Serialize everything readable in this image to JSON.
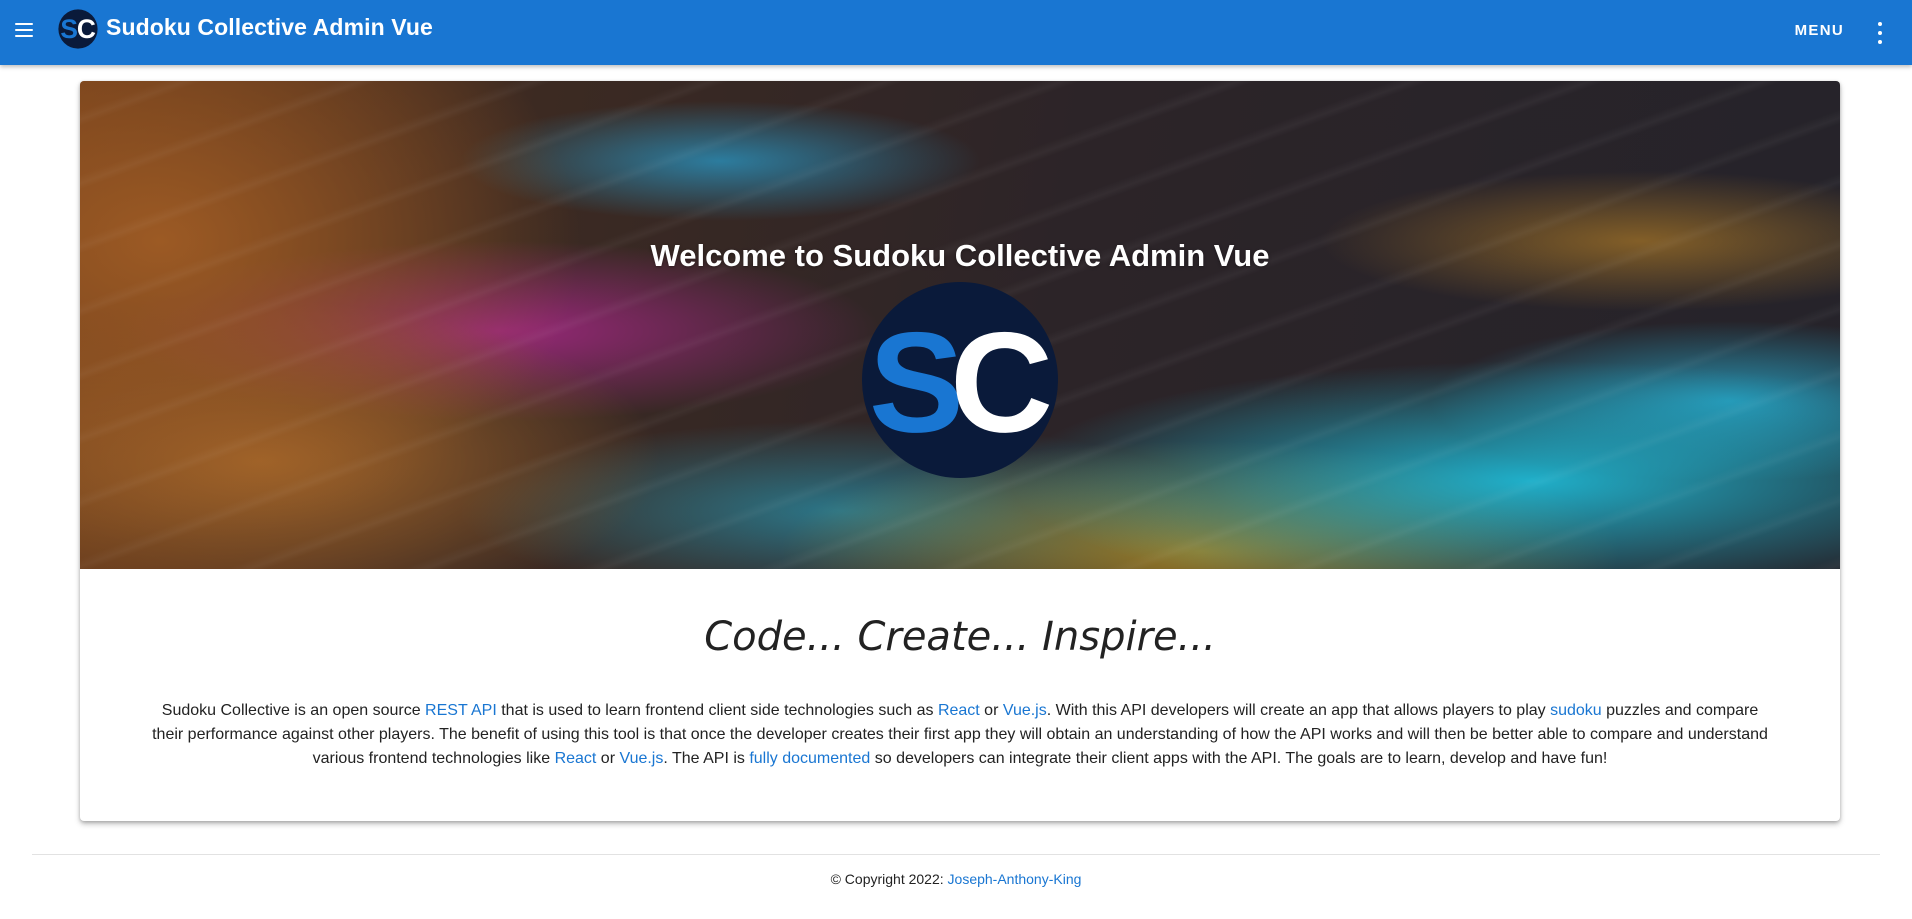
{
  "appbar": {
    "title": "Sudoku Collective Admin Vue",
    "logo_text": "SC",
    "menu_label": "MENU",
    "nav_icon": "hamburger-menu-icon",
    "overflow_icon": "more-vert-icon",
    "color": "#1976d2"
  },
  "hero": {
    "title": "Welcome to Sudoku Collective Admin Vue",
    "logo_text": "SC"
  },
  "tagline": "Code... Create... Inspire...",
  "description": {
    "seg1": "Sudoku Collective is an open source ",
    "link_rest_api": "REST API",
    "seg2": " that is used to learn frontend client side technologies such as ",
    "link_react_1": "React",
    "seg3": " or ",
    "link_vue_1": "Vue.js",
    "seg4": ". With this API developers will create an app that allows players to play ",
    "link_sudoku": "sudoku",
    "seg5": " puzzles and compare their performance against other players. The benefit of using this tool is that once the developer creates their first app they will obtain an understanding of how the API works and will then be better able to compare and understand various frontend technologies like ",
    "link_react_2": "React",
    "seg6": " or ",
    "link_vue_2": "Vue.js",
    "seg7": ". The API is ",
    "link_docs": "fully documented",
    "seg8": " so developers can integrate their client apps with the API. The goals are to learn, develop and have fun!"
  },
  "footer": {
    "copyright": "© Copyright 2022: ",
    "author_link": "Joseph-Anthony-King"
  },
  "colors": {
    "link": "#1976d2",
    "logo_navy": "#0a1a3a",
    "logo_blue": "#1976d2"
  }
}
